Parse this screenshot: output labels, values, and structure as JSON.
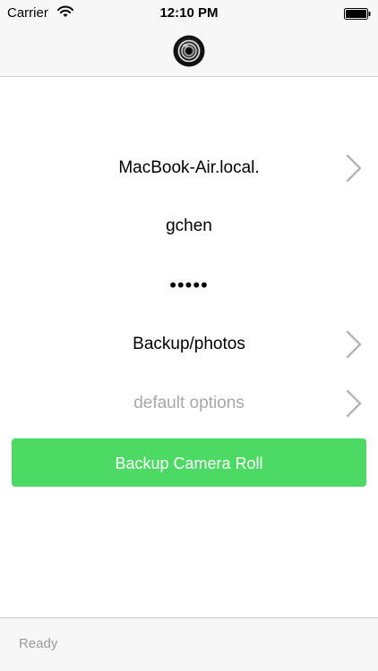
{
  "status_bar": {
    "carrier": "Carrier",
    "time": "12:10 PM",
    "wifi_icon": "wifi-icon",
    "battery_icon": "battery-icon"
  },
  "nav_bar": {
    "logo_icon": "camera-lens-icon"
  },
  "form": {
    "host": "MacBook-Air.local.",
    "username": "gchen",
    "password_mask": "•••••",
    "folder": "Backup/photos",
    "options": "default options",
    "chevron_icon": "chevron-right-icon"
  },
  "backup_button": {
    "label": "Backup Camera Roll",
    "color": "#4cd964"
  },
  "footer": {
    "status": "Ready"
  },
  "colors": {
    "bar_background": "#f7f7f7",
    "muted_text": "#a8a8a8",
    "chevron": "#b6b6b6"
  }
}
